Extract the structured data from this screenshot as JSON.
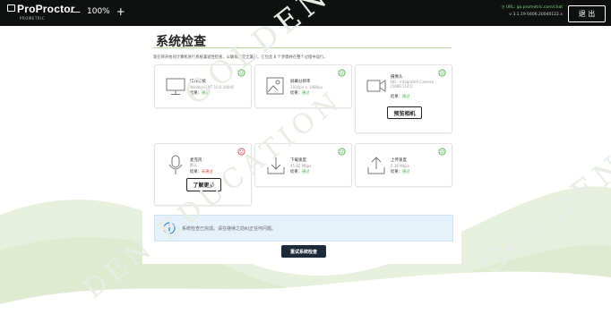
{
  "topbar": {
    "logo_text": "ProProctor",
    "logo_sub": "PROMETRIC",
    "zoom_out": "—",
    "zoom_level": "100%",
    "zoom_in": "+",
    "url": "go.prometric.com/chat",
    "version": "v 3.1.19 0406.20040122.x",
    "exit": "退 出"
  },
  "page": {
    "title": "系统检查",
    "description": "现在将开始对计算机进行系统兼容性检查，以确保其完全兼容。它包含 6 个步骤并在整个过程中运行。"
  },
  "checks": [
    {
      "name": "操作系统",
      "detail": "Windows_NT 10.0.19045",
      "result_label": "结果：",
      "result": "通过",
      "status": "pass"
    },
    {
      "name": "屏幕分辨率",
      "detail": "1920px × 1080px",
      "result_label": "结果：",
      "result": "通过",
      "status": "pass"
    },
    {
      "name": "摄像头",
      "detail": "HD - Integrated Camera (5986:1141)",
      "result_label": "结果：",
      "result": "通过",
      "status": "pass",
      "button": "预览相机"
    },
    {
      "name": "麦克风",
      "detail": "默认",
      "result_label": "结果：",
      "result": "未通过",
      "status": "fail",
      "button": "了解更多"
    },
    {
      "name": "下载速度",
      "detail": "45.82 Mbps",
      "result_label": "结果：",
      "result": "通过",
      "status": "pass"
    },
    {
      "name": "上传速度",
      "detail": "5.36 Mbps",
      "result_label": "结果：",
      "result": "通过",
      "status": "pass"
    }
  ],
  "info_message": "系统检查已完成。请在继续之前纠正任何问题。",
  "rerun_button": "重试系统检查",
  "watermark": [
    "GOLDEN",
    "DEN EDUCATION",
    "GOLDEN"
  ],
  "colors": {
    "pass": "#4caf50",
    "fail": "#e04848",
    "accent_green": "#b7d9a0",
    "topbar": "#0f1111"
  }
}
